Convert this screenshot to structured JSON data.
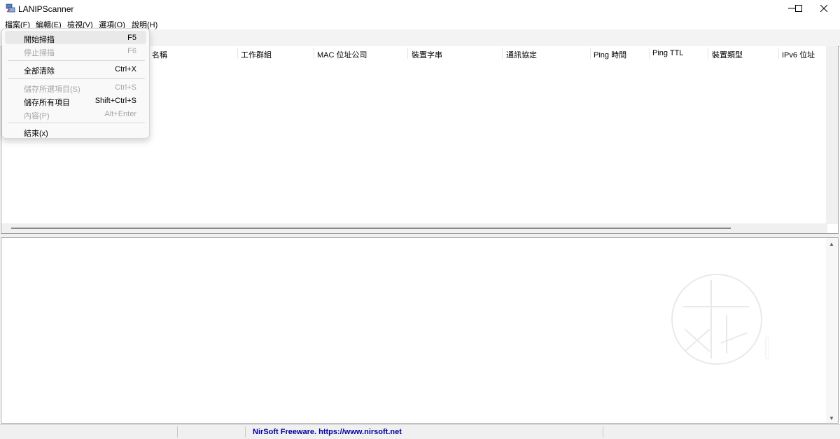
{
  "window": {
    "title": "LANIPScanner",
    "app_icon": "network-scanner-icon",
    "controls": [
      "minimize-icon",
      "maximize-icon",
      "close-icon"
    ]
  },
  "menubar": {
    "items": [
      {
        "label": "檔案(F)"
      },
      {
        "label": "編輯(E)"
      },
      {
        "label": "檢視(V)"
      },
      {
        "label": "選項(O)"
      },
      {
        "label": "說明(H)"
      }
    ]
  },
  "file_menu": {
    "items": [
      {
        "label": "開始掃描",
        "shortcut": "F5",
        "enabled": true,
        "highlighted": true
      },
      {
        "label": "停止掃描",
        "shortcut": "F6",
        "enabled": false
      },
      {
        "label": "全部清除",
        "shortcut": "Ctrl+X",
        "enabled": true
      },
      {
        "label": "儲存所選項目(S)",
        "shortcut": "Ctrl+S",
        "enabled": false
      },
      {
        "label": "儲存所有項目",
        "shortcut": "Shift+Ctrl+S",
        "enabled": true
      },
      {
        "label": "內容(P)",
        "shortcut": "Alt+Enter",
        "enabled": false
      },
      {
        "label": "結束(x)",
        "shortcut": "",
        "enabled": true
      }
    ]
  },
  "table": {
    "columns": [
      "名稱",
      "工作群組",
      "MAC 位址公司",
      "裝置字串",
      "通訊協定",
      "Ping 時間",
      "Ping TTL",
      "裝置類型",
      "IPv6 位址"
    ]
  },
  "statusbar": {
    "link_text": "NirSoft Freeware. https://www.nirsoft.net"
  },
  "colors": {
    "status_link": "#0000a0",
    "menu_highlight": "#e9e9e9",
    "disabled_text": "#a6a6a6"
  }
}
